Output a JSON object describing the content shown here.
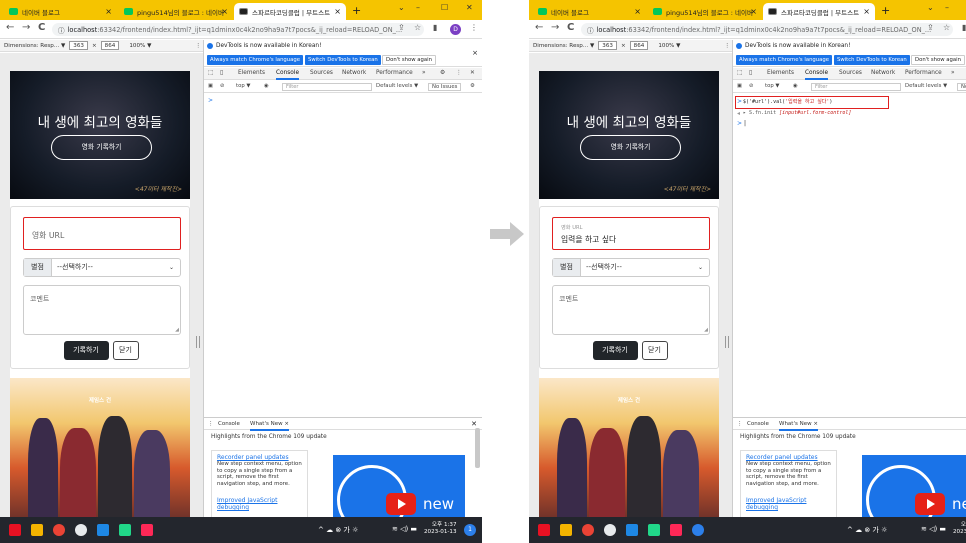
{
  "browser": {
    "tabs": [
      {
        "label": "네이버 블로그"
      },
      {
        "label": "pingu514님의 블로그 : 네이버"
      },
      {
        "label": "스파르타코딩클럽 | 부트스트"
      }
    ],
    "tab_close": "×",
    "new_tab": "+",
    "window": {
      "chevron": "⌄",
      "minimize": "–",
      "maximize": "☐",
      "close": "✕"
    },
    "nav": {
      "back": "←",
      "forward": "→",
      "reload": "C"
    },
    "url_info": "ⓘ",
    "url_host": "localhost",
    "url_rest": ":63342/frontend/index.html?_ijt=q1dminx0c4k2no9ha9a7t7pocs&_ij_reload=RELOAD_ON_...",
    "share": "⇪",
    "star": "☆",
    "sidebar": "▮",
    "avatar": "D",
    "menu": "⋮"
  },
  "device_toolbar": {
    "dimensions_label": "Dimensions: Resp... ▼",
    "width": "363",
    "times": "×",
    "height": "864",
    "zoom": "100% ▼",
    "menu": "⋮"
  },
  "webpage": {
    "hero_title": "내 생에 최고의 영화들",
    "hero_button": "영화 기록하기",
    "hero_caption": "<47미터 제작진>",
    "url_placeholder": "영화 URL",
    "url_typed_value": "입력을 하고 싶다",
    "star_label": "별점",
    "star_select": "--선택하기--",
    "chevron": "⌄",
    "comment_placeholder": "코멘트",
    "grip": "◢",
    "save_button": "기록하기",
    "close_button": "닫기",
    "poster_title": "제임스 건"
  },
  "devtools": {
    "notice_text": "DevTools is now available in Korean!",
    "btn_match": "Always match Chrome's language",
    "btn_switch": "Switch DevTools to Korean",
    "btn_dont_show": "Don't show again",
    "close": "×",
    "panels": [
      "Elements",
      "Console",
      "Sources",
      "Network",
      "Performance"
    ],
    "more_panels": "»",
    "settings": "⚙",
    "menu": "⋮",
    "close_devtools": "✕",
    "toolbar": {
      "top": "top ▼",
      "eye": "◉",
      "clear": "⊘",
      "filter_placeholder": "Filter",
      "levels": "Default levels ▼",
      "issues": "No Issues",
      "gear": "⚙"
    },
    "prompt_symbol": ">",
    "result_symbol": "◂",
    "console_command_prefix": "$('#url').val(",
    "console_command_string": "'입력을 하고 싶다'",
    "console_command_suffix": ")",
    "console_result_prefix": "▸ S.fn.init ",
    "console_result_value": "[input#url.form-control]",
    "cursor_line": "|",
    "drawer": {
      "tab_console": "Console",
      "tab_whats_new": "What's New",
      "close": "×",
      "highlights": "Highlights from the Chrome 109 update",
      "items": [
        {
          "title": "Recorder panel updates",
          "desc": "New step context menu, option to copy a single step from a script, remove the first navigation step, and more."
        },
        {
          "title": "Improved JavaScript",
          "desc": "debugging"
        }
      ],
      "video_label": "new"
    }
  },
  "taskbar": {
    "tray_left": "^ ☁ ⊗ 가 ☼",
    "tray_right": "≋ ◁) ▬",
    "time": "오후 1:37",
    "date": "2023-01-13",
    "notification_count": "1"
  }
}
